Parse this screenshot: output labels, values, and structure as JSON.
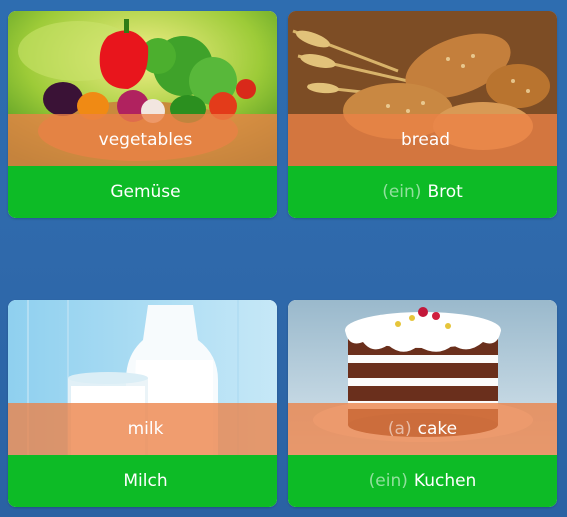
{
  "cards": [
    {
      "english": "vegetables",
      "english_article": "",
      "german_article": "",
      "german": "Gemüse",
      "image": "vegetables-in-basket-photo"
    },
    {
      "english": "bread",
      "english_article": "",
      "german_article": "(ein)",
      "german": "Brot",
      "image": "bread-loaves-photo"
    },
    {
      "english": "milk",
      "english_article": "",
      "german_article": "",
      "german": "Milch",
      "image": "milk-bottle-and-glass-photo"
    },
    {
      "english": "cake",
      "english_article": "(a)",
      "german_article": "(ein)",
      "german": "Kuchen",
      "image": "layer-cake-photo"
    }
  ],
  "colors": {
    "background": "#2e6db0",
    "english_band": "#ec8146",
    "german_band": "#0dbb26",
    "article_text": "#ffffff8c"
  }
}
